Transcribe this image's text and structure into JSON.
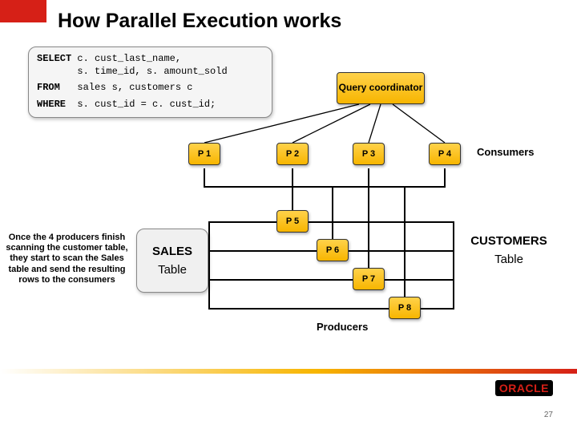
{
  "title": "How Parallel Execution works",
  "sql": {
    "line1a": "SELECT ",
    "line1b": "c. cust_last_name,",
    "line2": "       s. time_id, s. amount_sold",
    "line3a": "FROM   ",
    "line3b": "sales s, customers c",
    "line4a": "WHERE  ",
    "line4b": "s. cust_id = c. cust_id;"
  },
  "qc": "Query coordinator",
  "consumers_label": "Consumers",
  "consumers": {
    "p1": "P 1",
    "p2": "P 2",
    "p3": "P 3",
    "p4": "P 4"
  },
  "producers": {
    "p5": "P 5",
    "p6": "P 6",
    "p7": "P 7",
    "p8": "P 8"
  },
  "producers_label": "Producers",
  "caption_left": "Once the 4 producers finish scanning the customer table, they start to scan the Sales table and send the resulting rows to the consumers",
  "sales": {
    "l1": "SALES",
    "l2": "Table"
  },
  "customers": {
    "l1": "CUSTOMERS",
    "l2": "Table"
  },
  "logo": "ORACLE",
  "page": "27",
  "colors": {
    "accent_red": "#d62017",
    "accent_yellow": "#f7b500"
  }
}
